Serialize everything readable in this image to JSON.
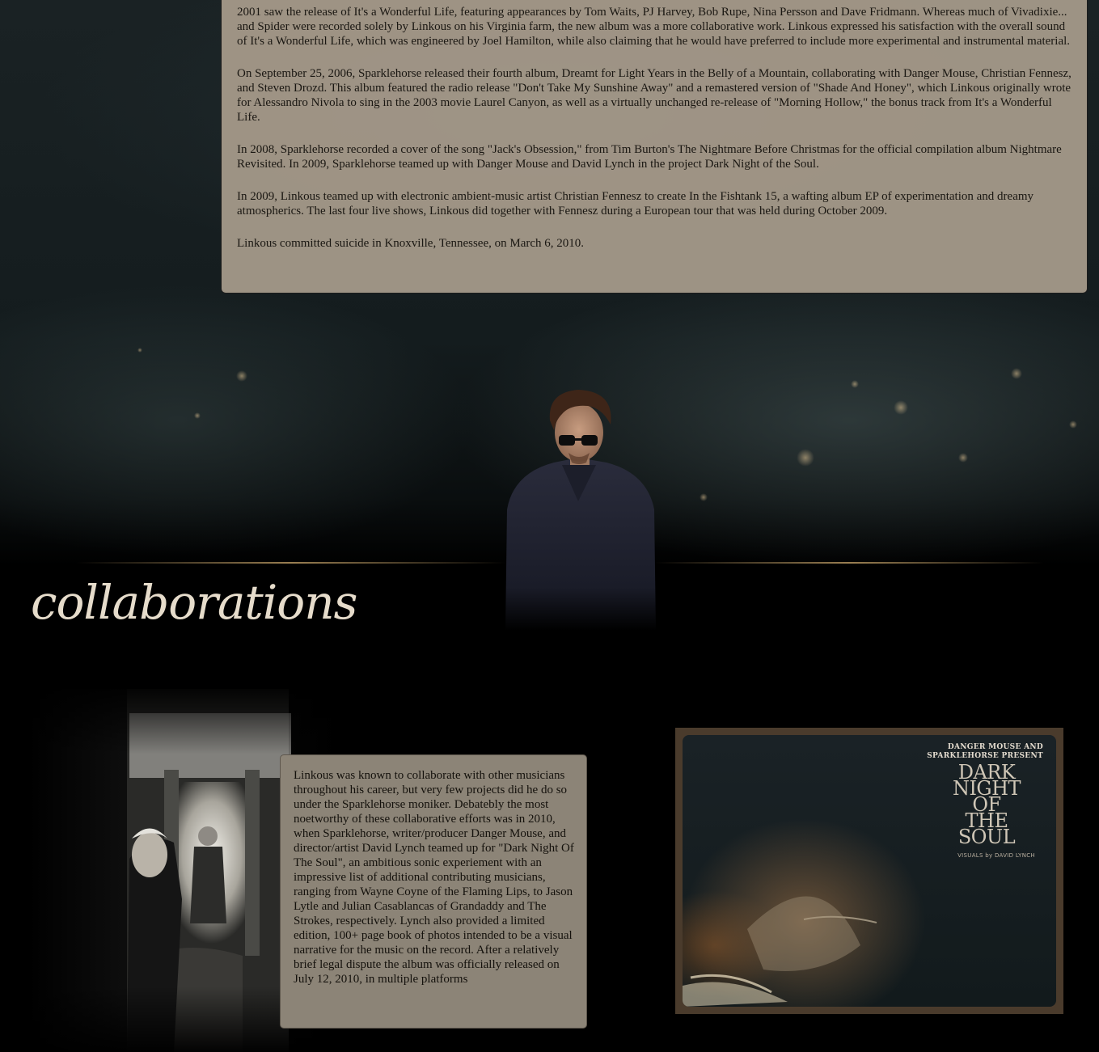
{
  "history": {
    "paragraphs": [
      "2001 saw the release of It's a Wonderful Life, featuring appearances by Tom Waits, PJ Harvey, Bob Rupe, Nina Persson and Dave Fridmann. Whereas much of Vivadixie... and Spider were recorded solely by Linkous on his Virginia farm, the new album was a more collaborative work. Linkous expressed his satisfaction with the overall sound of It's a Wonderful Life, which was engineered by Joel Hamilton, while also claiming that he would have preferred to include more experimental and instrumental material.",
      "On September 25, 2006, Sparklehorse released their fourth album, Dreamt for Light Years in the Belly of a Mountain, collaborating with Danger Mouse, Christian Fennesz, and Steven Drozd. This album featured the radio release \"Don't Take My Sunshine Away\" and a remastered version of \"Shade And Honey\", which Linkous originally wrote for Alessandro Nivola to sing in the 2003 movie Laurel Canyon, as well as a virtually unchanged re-release of \"Morning Hollow,\" the bonus track from It's a Wonderful Life.",
      "In 2008, Sparklehorse recorded a cover of the song \"Jack's Obsession,\" from Tim Burton's The Nightmare Before Christmas for the official compilation album Nightmare Revisited. In 2009, Sparklehorse teamed up with Danger Mouse and David Lynch in the project Dark Night of the Soul.",
      "In 2009, Linkous teamed up with electronic ambient-music artist Christian Fennesz to create In the Fishtank 15, a wafting album EP of experimentation and dreamy atmospherics. The last four live shows, Linkous did together with Fennesz during a European tour that was held during October 2009.",
      "Linkous committed suicide in Knoxville, Tennessee, on March 6, 2010."
    ]
  },
  "collaborations": {
    "heading": "collaborations",
    "body": "Linkous was known to collaborate with other musicians throughout his career, but very few projects did he do so under the Sparklehorse moniker. Debatebly the most noetworthy of these collaborative efforts was in 2010, when Sparklehorse, writer/producer Danger Mouse, and director/artist David Lynch teamed up for \"Dark Night Of The Soul\", an ambitious sonic experiement with an impressive list of additional contributing musicians, ranging from Wayne Coyne of the Flaming Lips, to Jason Lytle and Julian Casablancas of Grandaddy and The Strokes, respectively. Lynch also provided a limited edition, 100+ page book of photos intended to be a visual narrative for the music on the record. After a relatively brief legal dispute the album was officially released on July 12, 2010, in multiple platforms",
    "album": {
      "artist_line_1": "DANGER MOUSE AND",
      "artist_line_2": "SPARKLEHORSE PRESENT",
      "title": "DARK\nNIGHT\nOF\nTHE\nSOUL",
      "visuals": "VISUALS by DAVID LYNCH"
    }
  },
  "colors": {
    "panel_bg": "#a89c8c",
    "collab_panel_bg": "#8c8477",
    "heading_text": "#e6dccb",
    "page_bg": "#000000",
    "accent_line": "#aa8c5a"
  }
}
